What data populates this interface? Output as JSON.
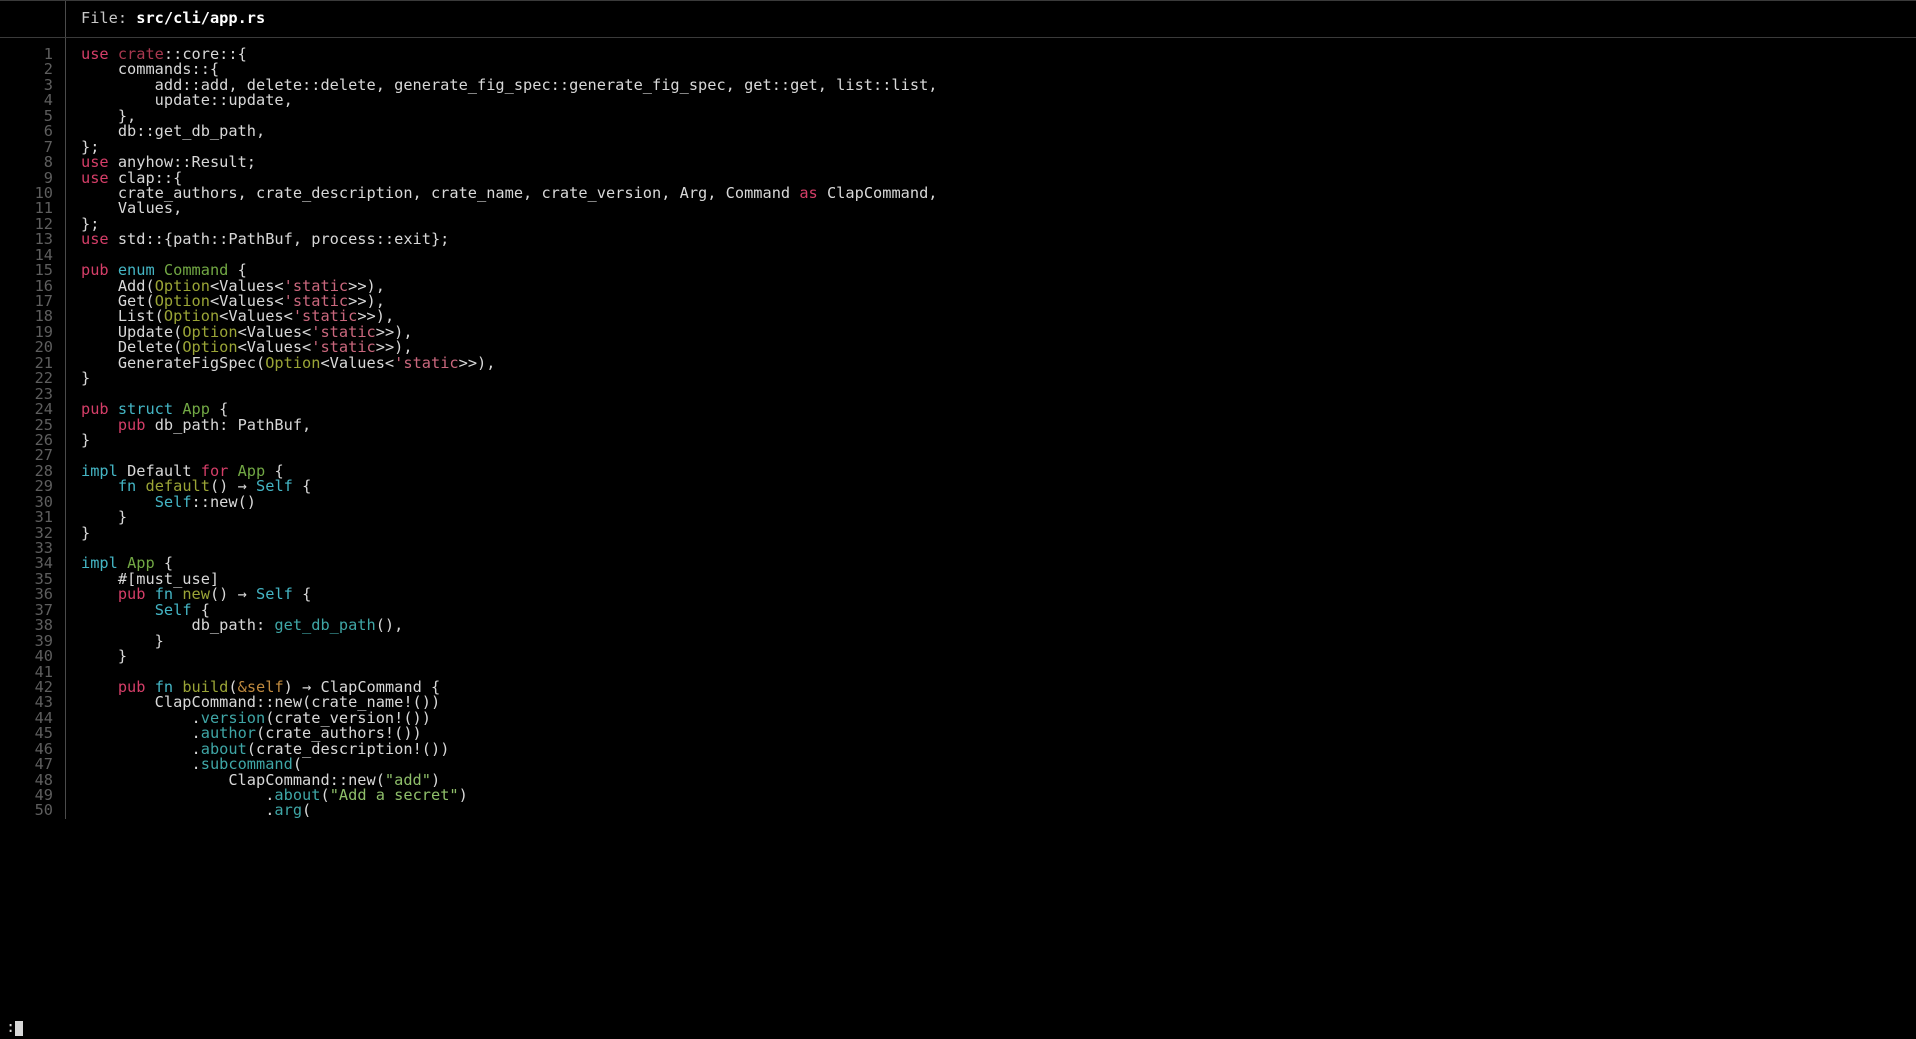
{
  "header": {
    "label": "File: ",
    "filename": "src/cli/app.rs"
  },
  "status": {
    "prompt": ":",
    "cursor": "block"
  },
  "editor": {
    "first_line": 1,
    "last_line": 50,
    "total_visible_lines": 50
  },
  "colors": {
    "background": "#000000",
    "foreground": "#d8d8d8",
    "gutter_text": "#5e5e5e",
    "gutter_rule": "#4b4b4b",
    "header_rule": "#3a3a3a",
    "keyword": "#d53e68",
    "control_keyword": "#44b5c4",
    "type_name": "#72a844",
    "generic_type": "#9aa436",
    "crate_word": "#a8384f",
    "lifetime": "#c9677d",
    "function_call": "#3fa6a6",
    "self_ref": "#c08a3e",
    "string": "#8fbf6a"
  },
  "lines": [
    {
      "n": 1,
      "t": [
        [
          "k",
          "use "
        ],
        [
          "cr",
          "crate"
        ],
        [
          "p",
          "::core::{"
        ]
      ]
    },
    {
      "n": 2,
      "t": [
        [
          "p",
          "    commands::{"
        ]
      ]
    },
    {
      "n": 3,
      "t": [
        [
          "p",
          "        add::add, delete::delete, generate_fig_spec::generate_fig_spec, get::get, list::list,"
        ]
      ]
    },
    {
      "n": 4,
      "t": [
        [
          "p",
          "        update::update,"
        ]
      ]
    },
    {
      "n": 5,
      "t": [
        [
          "p",
          "    },"
        ]
      ]
    },
    {
      "n": 6,
      "t": [
        [
          "p",
          "    db::get_db_path,"
        ]
      ]
    },
    {
      "n": 7,
      "t": [
        [
          "p",
          "};"
        ]
      ]
    },
    {
      "n": 8,
      "t": [
        [
          "k",
          "use "
        ],
        [
          "p",
          "anyhow::Result;"
        ]
      ]
    },
    {
      "n": 9,
      "t": [
        [
          "k",
          "use "
        ],
        [
          "p",
          "clap::{"
        ]
      ]
    },
    {
      "n": 10,
      "t": [
        [
          "p",
          "    crate_authors, crate_description, crate_name, crate_version, Arg, Command "
        ],
        [
          "k",
          "as"
        ],
        [
          "p",
          " ClapCommand,"
        ]
      ]
    },
    {
      "n": 11,
      "t": [
        [
          "p",
          "    Values,"
        ]
      ]
    },
    {
      "n": 12,
      "t": [
        [
          "p",
          "};"
        ]
      ]
    },
    {
      "n": 13,
      "t": [
        [
          "k",
          "use "
        ],
        [
          "p",
          "std::{path::PathBuf, process::exit};"
        ]
      ]
    },
    {
      "n": 14,
      "t": [
        [
          "p",
          ""
        ]
      ]
    },
    {
      "n": 15,
      "t": [
        [
          "k",
          "pub "
        ],
        [
          "kc",
          "enum "
        ],
        [
          "ty",
          "Command"
        ],
        [
          "p",
          " {"
        ]
      ]
    },
    {
      "n": 16,
      "t": [
        [
          "p",
          "    Add("
        ],
        [
          "ot",
          "Option"
        ],
        [
          "p",
          "<Values<"
        ],
        [
          "st",
          "'static"
        ],
        [
          "p",
          ">>),"
        ]
      ]
    },
    {
      "n": 17,
      "t": [
        [
          "p",
          "    Get("
        ],
        [
          "ot",
          "Option"
        ],
        [
          "p",
          "<Values<"
        ],
        [
          "st",
          "'static"
        ],
        [
          "p",
          ">>),"
        ]
      ]
    },
    {
      "n": 18,
      "t": [
        [
          "p",
          "    List("
        ],
        [
          "ot",
          "Option"
        ],
        [
          "p",
          "<Values<"
        ],
        [
          "st",
          "'static"
        ],
        [
          "p",
          ">>),"
        ]
      ]
    },
    {
      "n": 19,
      "t": [
        [
          "p",
          "    Update("
        ],
        [
          "ot",
          "Option"
        ],
        [
          "p",
          "<Values<"
        ],
        [
          "st",
          "'static"
        ],
        [
          "p",
          ">>),"
        ]
      ]
    },
    {
      "n": 20,
      "t": [
        [
          "p",
          "    Delete("
        ],
        [
          "ot",
          "Option"
        ],
        [
          "p",
          "<Values<"
        ],
        [
          "st",
          "'static"
        ],
        [
          "p",
          ">>),"
        ]
      ]
    },
    {
      "n": 21,
      "t": [
        [
          "p",
          "    GenerateFigSpec("
        ],
        [
          "ot",
          "Option"
        ],
        [
          "p",
          "<Values<"
        ],
        [
          "st",
          "'static"
        ],
        [
          "p",
          ">>),"
        ]
      ]
    },
    {
      "n": 22,
      "t": [
        [
          "p",
          "}"
        ]
      ]
    },
    {
      "n": 23,
      "t": [
        [
          "p",
          ""
        ]
      ]
    },
    {
      "n": 24,
      "t": [
        [
          "k",
          "pub "
        ],
        [
          "kc",
          "struct "
        ],
        [
          "ty",
          "App"
        ],
        [
          "p",
          " {"
        ]
      ]
    },
    {
      "n": 25,
      "t": [
        [
          "p",
          "    "
        ],
        [
          "k",
          "pub "
        ],
        [
          "p",
          "db_path: PathBuf,"
        ]
      ]
    },
    {
      "n": 26,
      "t": [
        [
          "p",
          "}"
        ]
      ]
    },
    {
      "n": 27,
      "t": [
        [
          "p",
          ""
        ]
      ]
    },
    {
      "n": 28,
      "t": [
        [
          "kc",
          "impl "
        ],
        [
          "p",
          "Default "
        ],
        [
          "k",
          "for "
        ],
        [
          "ty",
          "App"
        ],
        [
          "p",
          " {"
        ]
      ]
    },
    {
      "n": 29,
      "t": [
        [
          "p",
          "    "
        ],
        [
          "kc",
          "fn "
        ],
        [
          "ot",
          "default"
        ],
        [
          "p",
          "() "
        ],
        [
          "p",
          "→"
        ],
        [
          "p",
          " "
        ],
        [
          "kc",
          "Self"
        ],
        [
          "p",
          " {"
        ]
      ]
    },
    {
      "n": 30,
      "t": [
        [
          "p",
          "        "
        ],
        [
          "kc",
          "Self"
        ],
        [
          "p",
          "::new()"
        ]
      ]
    },
    {
      "n": 31,
      "t": [
        [
          "p",
          "    }"
        ]
      ]
    },
    {
      "n": 32,
      "t": [
        [
          "p",
          "}"
        ]
      ]
    },
    {
      "n": 33,
      "t": [
        [
          "p",
          ""
        ]
      ]
    },
    {
      "n": 34,
      "t": [
        [
          "kc",
          "impl "
        ],
        [
          "ty",
          "App"
        ],
        [
          "p",
          " {"
        ]
      ]
    },
    {
      "n": 35,
      "t": [
        [
          "p",
          "    #[must_use]"
        ]
      ]
    },
    {
      "n": 36,
      "t": [
        [
          "p",
          "    "
        ],
        [
          "k",
          "pub "
        ],
        [
          "kc",
          "fn "
        ],
        [
          "ot",
          "new"
        ],
        [
          "p",
          "() → "
        ],
        [
          "kc",
          "Self"
        ],
        [
          "p",
          " {"
        ]
      ]
    },
    {
      "n": 37,
      "t": [
        [
          "p",
          "        "
        ],
        [
          "kc",
          "Self"
        ],
        [
          "p",
          " {"
        ]
      ]
    },
    {
      "n": 38,
      "t": [
        [
          "p",
          "            db_path: "
        ],
        [
          "fn",
          "get_db_path"
        ],
        [
          "p",
          "(),"
        ]
      ]
    },
    {
      "n": 39,
      "t": [
        [
          "p",
          "        }"
        ]
      ]
    },
    {
      "n": 40,
      "t": [
        [
          "p",
          "    }"
        ]
      ]
    },
    {
      "n": 41,
      "t": [
        [
          "p",
          ""
        ]
      ]
    },
    {
      "n": 42,
      "t": [
        [
          "p",
          "    "
        ],
        [
          "k",
          "pub "
        ],
        [
          "kc",
          "fn "
        ],
        [
          "ot",
          "build"
        ],
        [
          "p",
          "("
        ],
        [
          "am",
          "&self"
        ],
        [
          "p",
          ") → ClapCommand {"
        ]
      ]
    },
    {
      "n": 43,
      "t": [
        [
          "p",
          "        ClapCommand::new(crate_name!())"
        ]
      ]
    },
    {
      "n": 44,
      "t": [
        [
          "p",
          "            ."
        ],
        [
          "fn",
          "version"
        ],
        [
          "p",
          "(crate_version!())"
        ]
      ]
    },
    {
      "n": 45,
      "t": [
        [
          "p",
          "            ."
        ],
        [
          "fn",
          "author"
        ],
        [
          "p",
          "(crate_authors!())"
        ]
      ]
    },
    {
      "n": 46,
      "t": [
        [
          "p",
          "            ."
        ],
        [
          "fn",
          "about"
        ],
        [
          "p",
          "(crate_description!())"
        ]
      ]
    },
    {
      "n": 47,
      "t": [
        [
          "p",
          "            ."
        ],
        [
          "fn",
          "subcommand"
        ],
        [
          "p",
          "("
        ]
      ]
    },
    {
      "n": 48,
      "t": [
        [
          "p",
          "                ClapCommand::new("
        ],
        [
          "s",
          "\"add\""
        ],
        [
          "p",
          ")"
        ]
      ]
    },
    {
      "n": 49,
      "t": [
        [
          "p",
          "                    ."
        ],
        [
          "fn",
          "about"
        ],
        [
          "p",
          "("
        ],
        [
          "s",
          "\"Add a secret\""
        ],
        [
          "p",
          ")"
        ]
      ]
    },
    {
      "n": 50,
      "t": [
        [
          "p",
          "                    ."
        ],
        [
          "fn",
          "arg"
        ],
        [
          "p",
          "("
        ]
      ]
    }
  ]
}
